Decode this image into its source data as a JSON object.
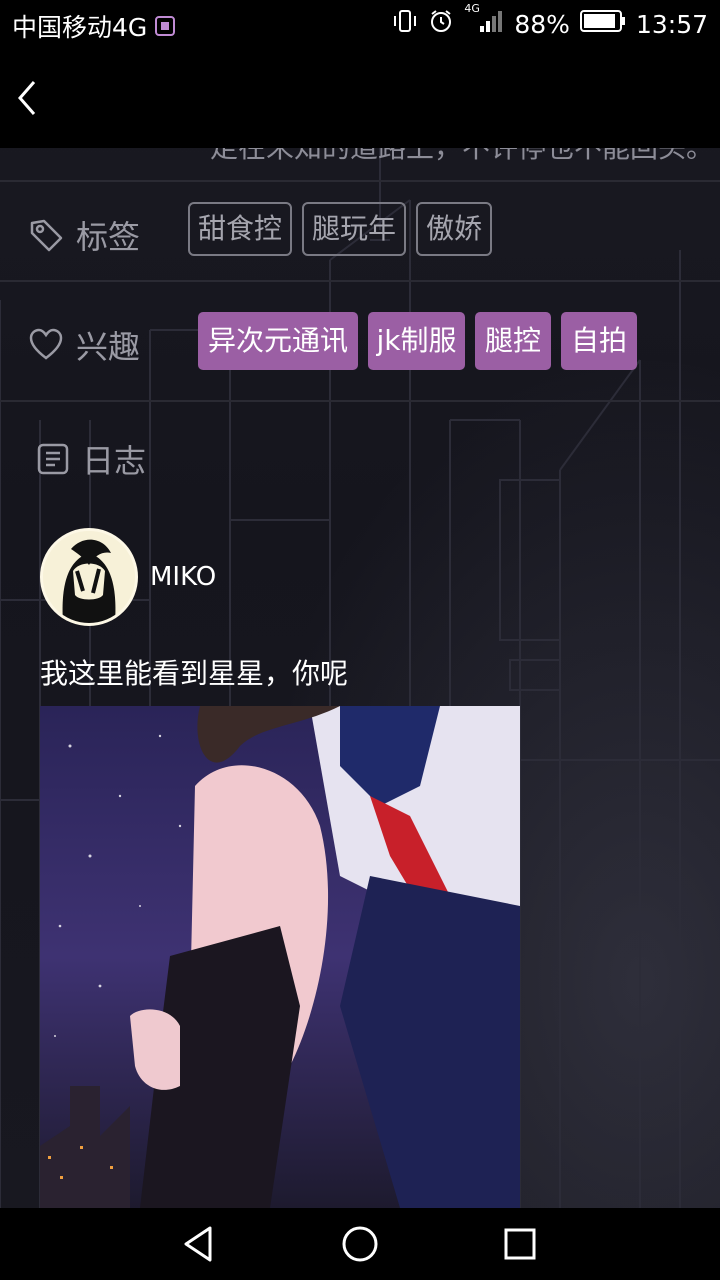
{
  "status_bar": {
    "carrier": "中国移动4G",
    "network": "4G",
    "battery": "88%",
    "time": "13:57"
  },
  "profile": {
    "cut_text": "走在未知的道路上，不许停也不能回头。",
    "tags_label": "标签",
    "tags": [
      "甜食控",
      "腿玩年",
      "傲娇"
    ],
    "interests_label": "兴趣",
    "interests": [
      "异次元通讯",
      "jk制服",
      "腿控",
      "自拍"
    ],
    "journal_label": "日志"
  },
  "post": {
    "username": "MIKO",
    "text": "我这里能看到星星，你呢"
  },
  "icons": {
    "back": "back-arrow-icon",
    "tag": "tag-icon",
    "heart": "heart-icon",
    "journal": "document-icon",
    "nav_back": "triangle-back-icon",
    "nav_home": "circle-home-icon",
    "nav_recent": "square-recent-icon"
  },
  "colors": {
    "accent": "#9b5fa4",
    "background": "#14141c",
    "bar": "#000000"
  }
}
